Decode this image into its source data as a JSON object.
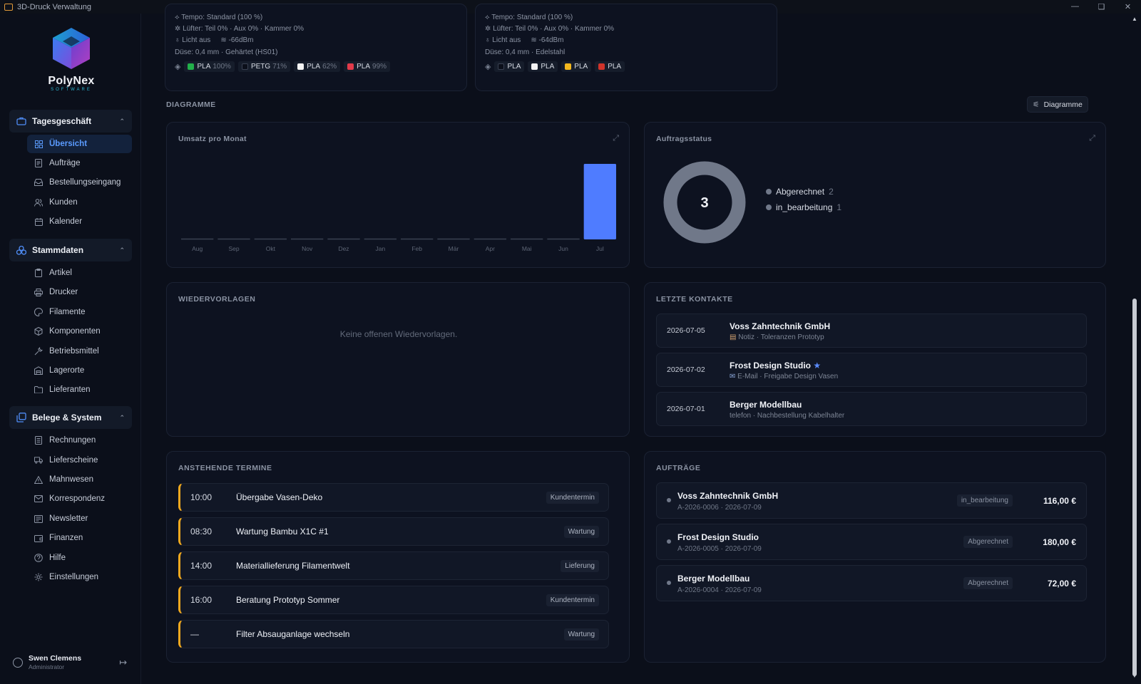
{
  "window": {
    "title": "3D-Druck Verwaltung",
    "minimize_icon": "minimize-icon",
    "maximize_icon": "restore-icon",
    "close_icon": "close-icon"
  },
  "brand": {
    "name": "PolyNex",
    "sub": "SOFTWARE"
  },
  "sidebar": {
    "sections": [
      {
        "label": "Tagesgeschäft",
        "icon": "briefcase-icon",
        "items": [
          {
            "label": "Übersicht",
            "icon": "dashboard-icon",
            "active": true
          },
          {
            "label": "Aufträge",
            "icon": "document-icon"
          },
          {
            "label": "Bestellungseingang",
            "icon": "inbox-icon"
          },
          {
            "label": "Kunden",
            "icon": "users-icon"
          },
          {
            "label": "Kalender",
            "icon": "calendar-icon"
          }
        ]
      },
      {
        "label": "Stammdaten",
        "icon": "layers-icon",
        "items": [
          {
            "label": "Artikel",
            "icon": "clipboard-icon"
          },
          {
            "label": "Drucker",
            "icon": "printer-icon"
          },
          {
            "label": "Filamente",
            "icon": "palette-icon"
          },
          {
            "label": "Komponenten",
            "icon": "box-icon"
          },
          {
            "label": "Betriebsmittel",
            "icon": "wrench-icon"
          },
          {
            "label": "Lagerorte",
            "icon": "warehouse-icon"
          },
          {
            "label": "Lieferanten",
            "icon": "folder-icon"
          }
        ]
      },
      {
        "label": "Belege & System",
        "icon": "receipts-icon",
        "items": [
          {
            "label": "Rechnungen",
            "icon": "invoice-icon"
          },
          {
            "label": "Lieferscheine",
            "icon": "truck-icon"
          },
          {
            "label": "Mahnwesen",
            "icon": "warning-icon"
          },
          {
            "label": "Korrespondenz",
            "icon": "mail-icon"
          },
          {
            "label": "Newsletter",
            "icon": "newsletter-icon"
          },
          {
            "label": "Finanzen",
            "icon": "wallet-icon"
          },
          {
            "label": "Hilfe",
            "icon": "help-icon"
          },
          {
            "label": "Einstellungen",
            "icon": "gear-icon"
          }
        ]
      }
    ],
    "user": {
      "name": "Swen Clemens",
      "role": "Administrator"
    }
  },
  "printers": [
    {
      "speed": "Tempo: Standard (100 %)",
      "fans": "Lüfter: Teil 0% · Aux 0% · Kammer 0%",
      "light": "Licht aus",
      "wifi": "-66dBm",
      "nozzle": "Düse: 0,4 mm · Gehärtet (HS01)",
      "slots": [
        {
          "material": "PLA",
          "pct": "100%",
          "color": "#22b04a"
        },
        {
          "material": "PETG",
          "pct": "71%",
          "color": "#0b0f1a"
        },
        {
          "material": "PLA",
          "pct": "62%",
          "color": "#f4f4f4"
        },
        {
          "material": "PLA",
          "pct": "99%",
          "color": "#e23a4a"
        }
      ]
    },
    {
      "speed": "Tempo: Standard (100 %)",
      "fans": "Lüfter: Teil 0% · Aux 0% · Kammer 0%",
      "light": "Licht aus",
      "wifi": "-64dBm",
      "nozzle": "Düse: 0,4 mm · Edelstahl",
      "slots": [
        {
          "material": "PLA",
          "pct": "",
          "color": "#0b0f1a"
        },
        {
          "material": "PLA",
          "pct": "",
          "color": "#f4f4f4"
        },
        {
          "material": "PLA",
          "pct": "",
          "color": "#f4b81e"
        },
        {
          "material": "PLA",
          "pct": "",
          "color": "#d0332a"
        }
      ]
    }
  ],
  "diagrams": {
    "section_title": "DIAGRAMME",
    "button_label": "Diagramme"
  },
  "chart_data": [
    {
      "type": "bar",
      "title": "Umsatz pro Monat",
      "categories": [
        "Aug",
        "Sep",
        "Okt",
        "Nov",
        "Dez",
        "Jan",
        "Feb",
        "Mär",
        "Apr",
        "Mai",
        "Jun",
        "Jul"
      ],
      "values": [
        0,
        0,
        0,
        0,
        0,
        0,
        0,
        0,
        0,
        0,
        0,
        368
      ],
      "color": "#4f7cff",
      "grid": false
    },
    {
      "type": "pie",
      "title": "Auftragsstatus",
      "center_label": "3",
      "labels": [
        "Abgerechnet",
        "in_bearbeitung"
      ],
      "values": [
        2,
        1
      ],
      "color": "#707889"
    }
  ],
  "wiedervorlagen": {
    "title": "WIEDERVORLAGEN",
    "empty": "Keine offenen Wiedervorlagen."
  },
  "kontakte": {
    "title": "LETZTE KONTAKTE",
    "rows": [
      {
        "date": "2026-07-05",
        "name": "Voss Zahntechnik GmbH",
        "detail": "Notiz · Toleranzen Prototyp",
        "icon": "note-icon",
        "starred": false
      },
      {
        "date": "2026-07-02",
        "name": "Frost Design Studio",
        "detail": "E-Mail · Freigabe Design Vasen",
        "icon": "email-icon",
        "starred": true
      },
      {
        "date": "2026-07-01",
        "name": "Berger Modellbau",
        "detail": "telefon · Nachbestellung Kabelhalter",
        "icon": "",
        "starred": false
      }
    ]
  },
  "termine": {
    "title": "ANSTEHENDE TERMINE",
    "rows": [
      {
        "time": "10:00",
        "title": "Übergabe Vasen-Deko",
        "tag": "Kundentermin"
      },
      {
        "time": "08:30",
        "title": "Wartung Bambu X1C #1",
        "tag": "Wartung"
      },
      {
        "time": "14:00",
        "title": "Materiallieferung Filamentwelt",
        "tag": "Lieferung"
      },
      {
        "time": "16:00",
        "title": "Beratung Prototyp Sommer",
        "tag": "Kundentermin"
      },
      {
        "time": "—",
        "title": "Filter Absauganlage wechseln",
        "tag": "Wartung"
      }
    ]
  },
  "auftraege": {
    "title": "AUFTRÄGE",
    "rows": [
      {
        "name": "Voss Zahntechnik GmbH",
        "detail": "A-2026-0006 · 2026-07-09",
        "status": "in_bearbeitung",
        "price": "116,00 €"
      },
      {
        "name": "Frost Design Studio",
        "detail": "A-2026-0005 · 2026-07-09",
        "status": "Abgerechnet",
        "price": "180,00 €"
      },
      {
        "name": "Berger Modellbau",
        "detail": "A-2026-0004 · 2026-07-09",
        "status": "Abgerechnet",
        "price": "72,00 €"
      }
    ]
  }
}
